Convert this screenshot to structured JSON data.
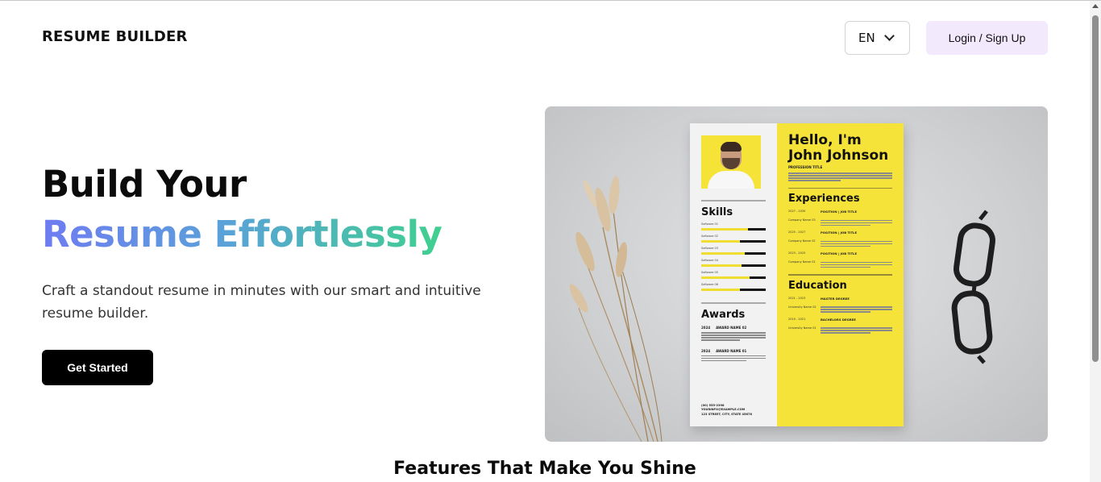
{
  "header": {
    "brand": "RESUME BUILDER",
    "language": "EN",
    "login_label": "Login / Sign Up"
  },
  "hero": {
    "title_line1": "Build Your",
    "title_line2": "Resume Effortlessly",
    "subtitle": "Craft a standout resume in minutes with our smart and intuitive resume builder.",
    "cta_label": "Get Started",
    "gradient_colors": [
      "#6f7bf2",
      "#5aa1d9",
      "#3fd08f"
    ]
  },
  "resume_preview": {
    "greeting_line1": "Hello, I'm",
    "greeting_line2": "John Johnson",
    "profession": "PROFESSION TITLE",
    "skills_heading": "Skills",
    "skills": [
      {
        "label": "Software 01",
        "level": 0.82
      },
      {
        "label": "Software 02",
        "level": 0.68
      },
      {
        "label": "Software 03",
        "level": 0.78
      },
      {
        "label": "Software 04",
        "level": 0.72
      },
      {
        "label": "Software 05",
        "level": 0.85
      },
      {
        "label": "Software 06",
        "level": 0.68
      }
    ],
    "awards_heading": "Awards",
    "awards": [
      {
        "year": "2024",
        "name": "AWARD NAME 02"
      },
      {
        "year": "2024",
        "name": "AWARD NAME 01"
      }
    ],
    "contact": [
      "(00) 555-2398",
      "YOURINFO@EXAMPLE.COM",
      "123 STREET, CITY, STATE 45678"
    ],
    "experiences_heading": "Experiences",
    "experiences": [
      {
        "period": "2027 - 2030",
        "title": "POSITION | JOB TITLE",
        "company": "Company Name 03"
      },
      {
        "period": "2025 - 2027",
        "title": "POSITION | JOB TITLE",
        "company": "Company Name 02"
      },
      {
        "period": "2023 - 2025",
        "title": "POSITION | JOB TITLE",
        "company": "Company Name 01"
      }
    ],
    "education_heading": "Education",
    "education": [
      {
        "period": "2021 - 2023",
        "degree": "MASTER DEGREE",
        "school": "University Name 02"
      },
      {
        "period": "2019 - 2021",
        "degree": "BACHELORS DEGREE",
        "school": "University Name 01"
      }
    ],
    "accent_color": "#f6e33a"
  },
  "features": {
    "heading": "Features That Make You Shine"
  }
}
